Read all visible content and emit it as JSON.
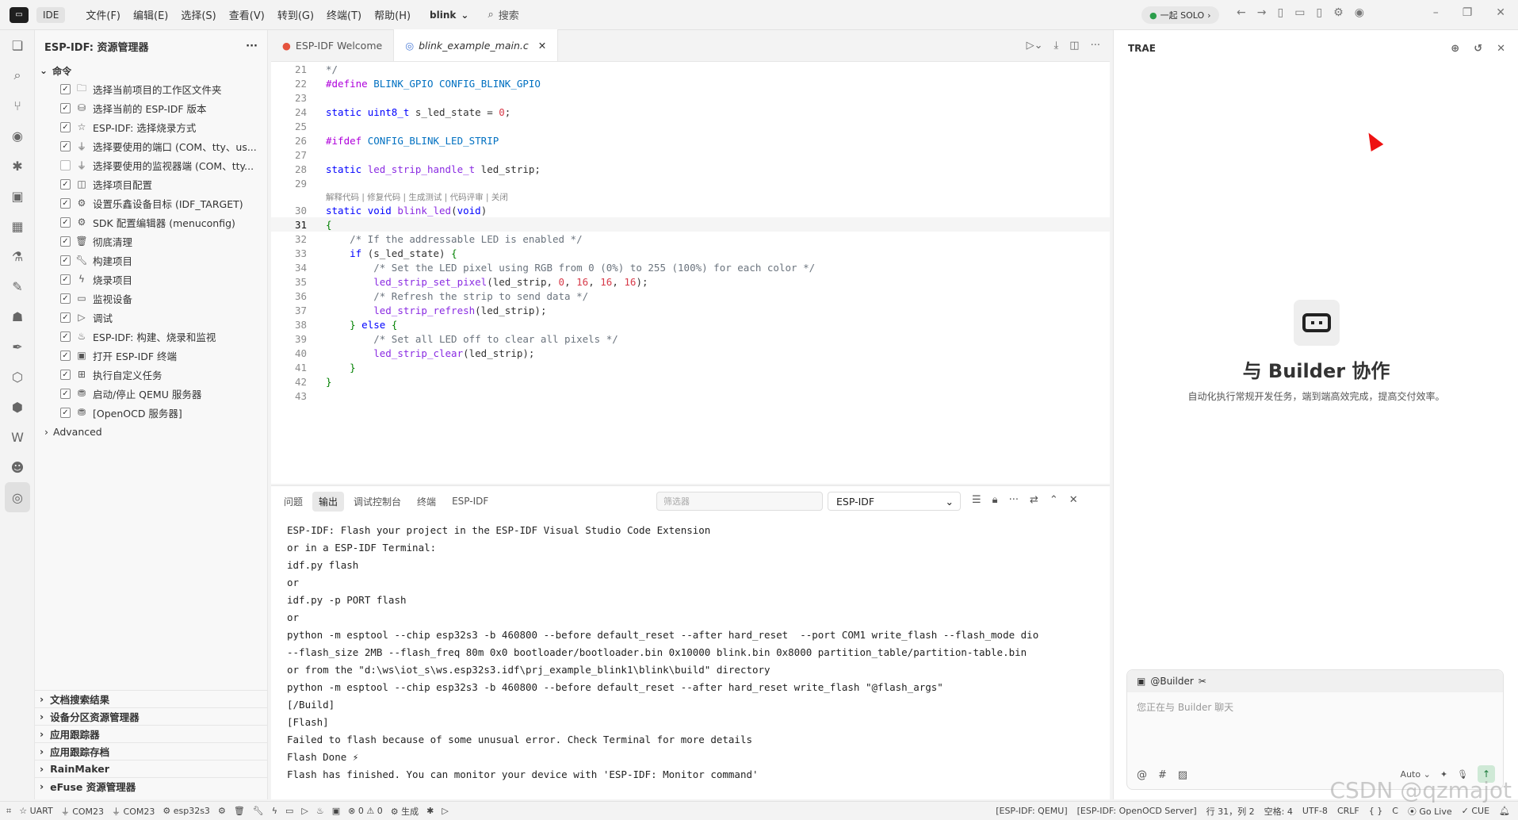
{
  "titlebar": {
    "ide_label": "IDE",
    "menu": [
      "文件(F)",
      "编辑(E)",
      "选择(S)",
      "查看(V)",
      "转到(G)",
      "终端(T)",
      "帮助(H)"
    ],
    "project": "blink",
    "search_placeholder": "搜索",
    "solo_label": "一起 SOLO"
  },
  "sidebar": {
    "title": "ESP-IDF: 资源管理器",
    "section": "命令",
    "commands": [
      {
        "label": "选择当前项目的工作区文件夹",
        "checked": true,
        "icon": "folder-icon"
      },
      {
        "label": "选择当前的 ESP-IDF 版本",
        "checked": true,
        "icon": "version-icon"
      },
      {
        "label": "ESP-IDF: 选择烧录方式",
        "checked": true,
        "icon": "star-icon"
      },
      {
        "label": "选择要使用的端口 (COM、tty、us...",
        "checked": true,
        "icon": "plug-icon"
      },
      {
        "label": "选择要使用的监视器端 (COM、tty...",
        "checked": false,
        "icon": "plug-icon"
      },
      {
        "label": "选择项目配置",
        "checked": true,
        "icon": "config-icon"
      },
      {
        "label": "设置乐鑫设备目标 (IDF_TARGET)",
        "checked": true,
        "icon": "chip-icon"
      },
      {
        "label": "SDK 配置编辑器 (menuconfig)",
        "checked": true,
        "icon": "gear-icon"
      },
      {
        "label": "彻底清理",
        "checked": true,
        "icon": "trash-icon"
      },
      {
        "label": "构建项目",
        "checked": true,
        "icon": "wrench-icon"
      },
      {
        "label": "烧录项目",
        "checked": true,
        "icon": "flash-icon"
      },
      {
        "label": "监视设备",
        "checked": true,
        "icon": "monitor-icon"
      },
      {
        "label": "调试",
        "checked": true,
        "icon": "debug-icon"
      },
      {
        "label": "ESP-IDF: 构建、烧录和监视",
        "checked": true,
        "icon": "flame-icon"
      },
      {
        "label": "打开 ESP-IDF 终端",
        "checked": true,
        "icon": "terminal-icon"
      },
      {
        "label": "执行自定义任务",
        "checked": true,
        "icon": "task-icon"
      },
      {
        "label": "启动/停止 QEMU 服务器",
        "checked": true,
        "icon": "server-icon"
      },
      {
        "label": "[OpenOCD 服务器]",
        "checked": true,
        "icon": "server-icon"
      }
    ],
    "advanced": "Advanced",
    "bottom_sections": [
      "文档搜索结果",
      "设备分区资源管理器",
      "应用跟踪器",
      "应用跟踪存档",
      "RainMaker",
      "eFuse 资源管理器"
    ]
  },
  "editor": {
    "tabs": [
      {
        "label": "ESP-IDF Welcome",
        "active": false
      },
      {
        "label": "blink_example_main.c",
        "active": true
      }
    ],
    "codelens": "解释代码 | 修复代码 | 生成测试 | 代码评审 | 关闭",
    "lines_before": [
      {
        "n": "21",
        "html": "<span class='cm'>*/</span>"
      },
      {
        "n": "22",
        "html": "<span class='pp'>#define</span> <span class='mac'>BLINK_GPIO</span> <span class='mac'>CONFIG_BLINK_GPIO</span>"
      },
      {
        "n": "23",
        "html": ""
      },
      {
        "n": "24",
        "html": "<span class='kw'>static</span> <span class='kw'>uint8_t</span> s_led_state = <span class='num'>0</span>;"
      },
      {
        "n": "25",
        "html": ""
      },
      {
        "n": "26",
        "html": "<span class='pp'>#ifdef</span> <span class='mac'>CONFIG_BLINK_LED_STRIP</span>"
      },
      {
        "n": "27",
        "html": ""
      },
      {
        "n": "28",
        "html": "<span class='kw'>static</span> <span class='purple'>led_strip_handle_t</span> led_strip;"
      },
      {
        "n": "29",
        "html": ""
      }
    ],
    "lines_after": [
      {
        "n": "30",
        "html": "<span class='kw'>static</span> <span class='kw'>void</span> <span class='purple'>blink_led</span>(<span class='kw'>void</span>)"
      },
      {
        "n": "31",
        "html": "<span class='kw2'>{</span>",
        "current": true
      },
      {
        "n": "32",
        "html": "    <span class='cm'>/* If the addressable LED is enabled */</span>"
      },
      {
        "n": "33",
        "html": "    <span class='kw'>if</span> (s_led_state) <span class='kw2'>{</span>"
      },
      {
        "n": "34",
        "html": "        <span class='cm'>/* Set the LED pixel using RGB from 0 (0%) to 255 (100%) for each color */</span>"
      },
      {
        "n": "35",
        "html": "        <span class='purple'>led_strip_set_pixel</span>(led_strip, <span class='num'>0</span>, <span class='num'>16</span>, <span class='num'>16</span>, <span class='num'>16</span>);"
      },
      {
        "n": "36",
        "html": "        <span class='cm'>/* Refresh the strip to send data */</span>"
      },
      {
        "n": "37",
        "html": "        <span class='purple'>led_strip_refresh</span>(led_strip);"
      },
      {
        "n": "38",
        "html": "    <span class='kw2'>}</span> <span class='kw'>else</span> <span class='kw2'>{</span>"
      },
      {
        "n": "39",
        "html": "        <span class='cm'>/* Set all LED off to clear all pixels */</span>"
      },
      {
        "n": "40",
        "html": "        <span class='purple'>led_strip_clear</span>(led_strip);"
      },
      {
        "n": "41",
        "html": "    <span class='kw2'>}</span>"
      },
      {
        "n": "42",
        "html": "<span class='kw2'>}</span>"
      },
      {
        "n": "43",
        "html": ""
      }
    ]
  },
  "panel": {
    "tabs": [
      "问题",
      "输出",
      "调试控制台",
      "终端",
      "ESP-IDF"
    ],
    "active_tab": "输出",
    "filter_placeholder": "筛选器",
    "output_source": "ESP-IDF",
    "output": [
      "ESP-IDF: Flash your project in the ESP-IDF Visual Studio Code Extension",
      "or in a ESP-IDF Terminal:",
      "idf.py flash",
      "or",
      "idf.py -p PORT flash",
      "or",
      "python -m esptool --chip esp32s3 -b 460800 --before default_reset --after hard_reset  --port COM1 write_flash --flash_mode dio",
      "--flash_size 2MB --flash_freq 80m 0x0 bootloader/bootloader.bin 0x10000 blink.bin 0x8000 partition_table/partition-table.bin",
      "or from the \"d:\\ws\\iot_s\\ws.esp32s3.idf\\prj_example_blink1\\blink\\build\" directory",
      "python -m esptool --chip esp32s3 -b 460800 --before default_reset --after hard_reset write_flash \"@flash_args\"",
      "[/Build]",
      "[Flash]",
      "Failed to flash because of some unusual error. Check Terminal for more details",
      "Flash Done ⚡",
      "Flash has finished. You can monitor your device with 'ESP-IDF: Monitor command'"
    ]
  },
  "builder": {
    "header": "TRAE",
    "title": "与 Builder 协作",
    "subtitle": "自动化执行常规开发任务，端到端高效完成，提高交付效率。",
    "chat_tag": "@Builder",
    "chat_placeholder": "您正在与 Builder 聊天",
    "mode": "Auto"
  },
  "statusbar": {
    "left": [
      "UART",
      "COM23",
      "COM23",
      "esp32s3",
      "0",
      "0",
      "生成"
    ],
    "right": [
      "[ESP-IDF: QEMU]",
      "[ESP-IDF: OpenOCD Server]",
      "行 31，列 2",
      "空格: 4",
      "UTF-8",
      "CRLF",
      "{ }",
      "C",
      "Go Live",
      "CUE"
    ]
  },
  "watermark": "CSDN @qzmajot"
}
